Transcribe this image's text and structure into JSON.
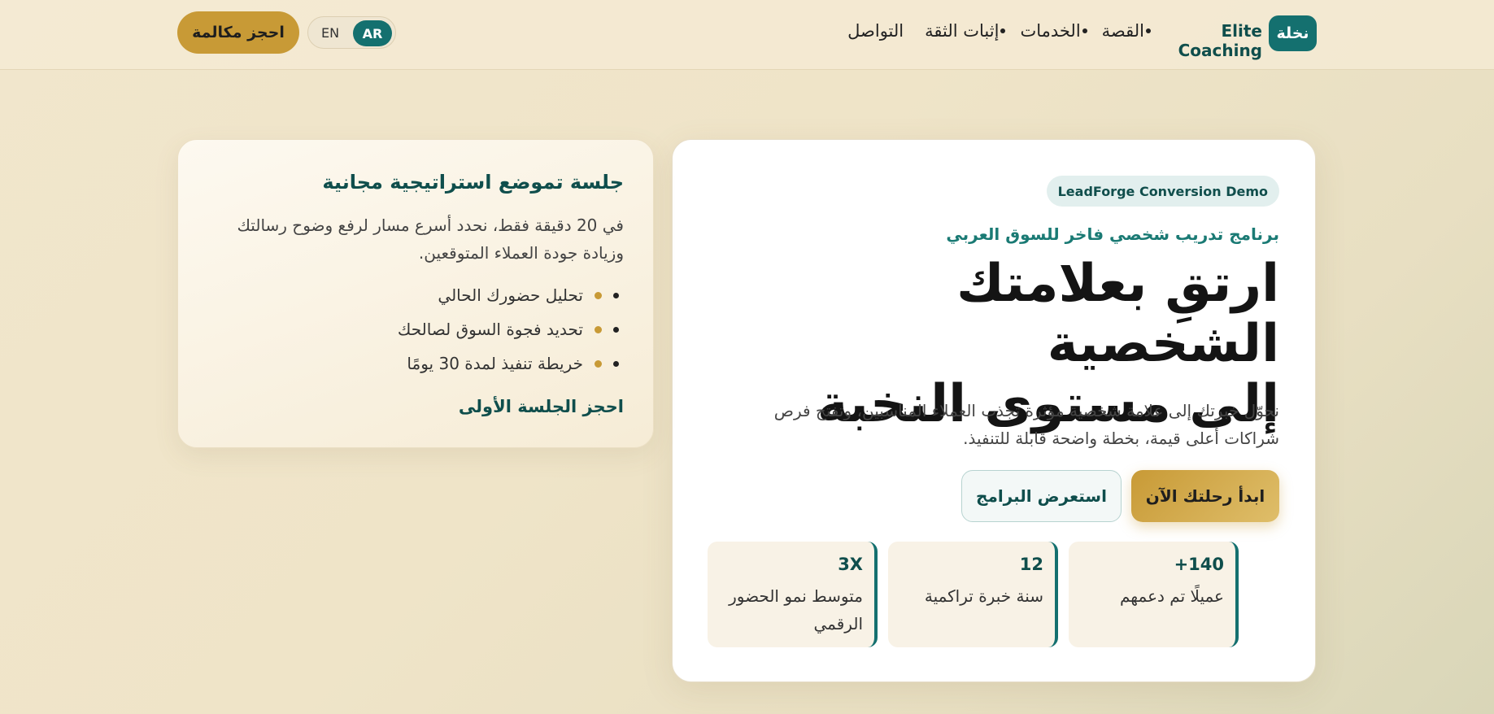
{
  "header": {
    "brand_badge": "نخلة",
    "brand_name": "Elite Coaching",
    "nav": [
      "القصة",
      "الخدمات",
      "إثبات الثقة",
      "التواصل"
    ],
    "lang": {
      "ar": "AR",
      "en": "EN"
    },
    "call_button": "احجز مكالمة"
  },
  "hero": {
    "tag": "LeadForge Conversion Demo",
    "subtitle": "برنامج تدريب شخصي فاخر للسوق العربي",
    "title_line1": "ارتقِ بعلامتك الشخصية",
    "title_line2": "إلى مستوى النخبة",
    "description": "نحوّل خبرتك إلى علامة شخصية مؤثرة تجذب العملاء المناسبين، وتفتح فرص شراكات أعلى قيمة، بخطة واضحة قابلة للتنفيذ.",
    "start_button": "ابدأ رحلتك الآن",
    "programs_button": "استعرض البرامج",
    "stats": [
      {
        "value": "+140",
        "label": "عميلًا تم دعمهم"
      },
      {
        "value": "12",
        "label": "سنة خبرة تراكمية"
      },
      {
        "value": "3X",
        "label": "متوسط نمو الحضور الرقمي"
      }
    ]
  },
  "side": {
    "title": "جلسة تموضع استراتيجية مجانية",
    "description": "في 20 دقيقة فقط، نحدد أسرع مسار لرفع وضوح رسالتك وزيادة جودة العملاء المتوقعين.",
    "items": [
      "تحليل حضورك الحالي",
      "تحديد فجوة السوق لصالحك",
      "خريطة تنفيذ لمدة 30 يومًا"
    ],
    "cta": "احجز الجلسة الأولى"
  }
}
